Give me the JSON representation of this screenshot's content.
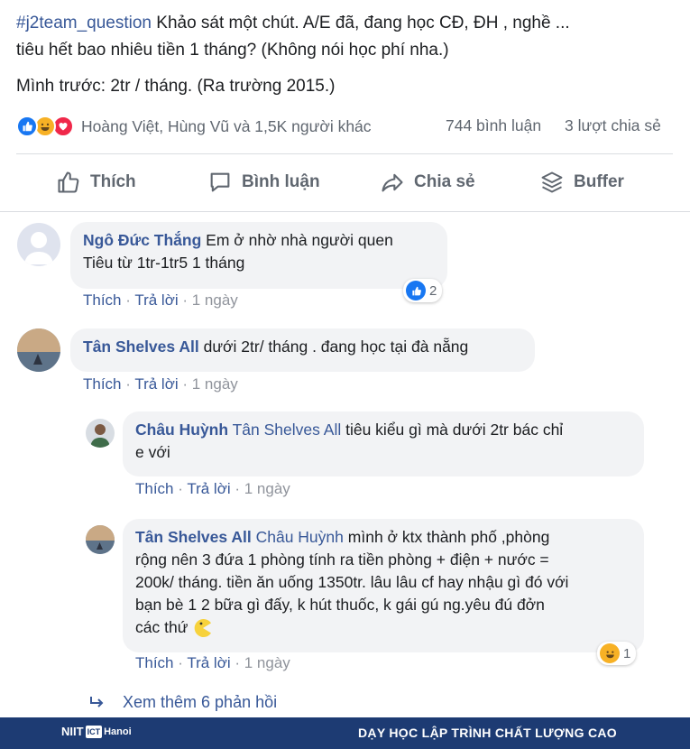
{
  "post": {
    "hashtag": "#j2team_question",
    "line1_text": " Khảo sát một chút. A/E đã, đang học CĐ, ĐH , nghề ...",
    "line2_text": "tiêu hết bao nhiêu tiền 1 tháng? (Không nói học phí nha.)",
    "line3_text": "Mình trước: 2tr / tháng. (Ra trường 2015.)"
  },
  "reactions": {
    "icons": [
      "like-icon",
      "haha-icon",
      "love-icon"
    ],
    "summary": "Hoàng Việt, Hùng Vũ và 1,5K người khác",
    "comments": "744 bình luận",
    "shares": "3 lượt chia sẻ"
  },
  "actions": {
    "like": "Thích",
    "comment": "Bình luận",
    "share": "Chia sẻ",
    "buffer": "Buffer"
  },
  "comments": [
    {
      "author": "Ngô Đức Thắng",
      "text_line1": "Em ở nhờ nhà người quen",
      "text_line2": "Tiêu từ 1tr-1tr5 1 tháng",
      "like": "Thích",
      "reply": "Trả lời",
      "time": "1 ngày",
      "reaction_count": "2"
    },
    {
      "author": "Tân Shelves All",
      "text_line1": "dưới 2tr/ tháng . đang học tại đà nẵng",
      "like": "Thích",
      "reply": "Trả lời",
      "time": "1 ngày"
    }
  ],
  "replies": [
    {
      "author": "Châu Huỳnh",
      "mention": "Tân Shelves All",
      "text_line1": "tiêu kiểu gì mà dưới 2tr bác chỉ",
      "text_line2": "e với",
      "like": "Thích",
      "reply": "Trả lời",
      "time": "1 ngày"
    },
    {
      "author": "Tân Shelves All",
      "mention": "Châu Huỳnh",
      "text_line1": "mình ở ktx thành phố ,phòng",
      "text_line2": "rộng nên 3 đứa 1 phòng tính ra tiền phòng + điện + nước =",
      "text_line3": "200k/ tháng. tiền ăn uống 1350tr. lâu lâu cf hay nhậu gì đó với",
      "text_line4": "bạn bè 1 2 bữa gì đấy, k hút thuốc, k gái gú ng.yêu đú đởn",
      "text_line5": "các thứ",
      "like": "Thích",
      "reply": "Trả lời",
      "time": "1 ngày",
      "reaction_count": "1"
    }
  ],
  "more_replies": "Xem thêm 6 phản hồi",
  "footer": {
    "logo": "NIIT",
    "logo_badge": "ICT",
    "logo_city": "Hanoi",
    "slogan": "DẠY HỌC LẬP TRÌNH CHẤT LƯỢNG CAO"
  },
  "colors": {
    "link": "#385898",
    "bubble": "#f2f3f5",
    "footer": "#1d3b73"
  }
}
